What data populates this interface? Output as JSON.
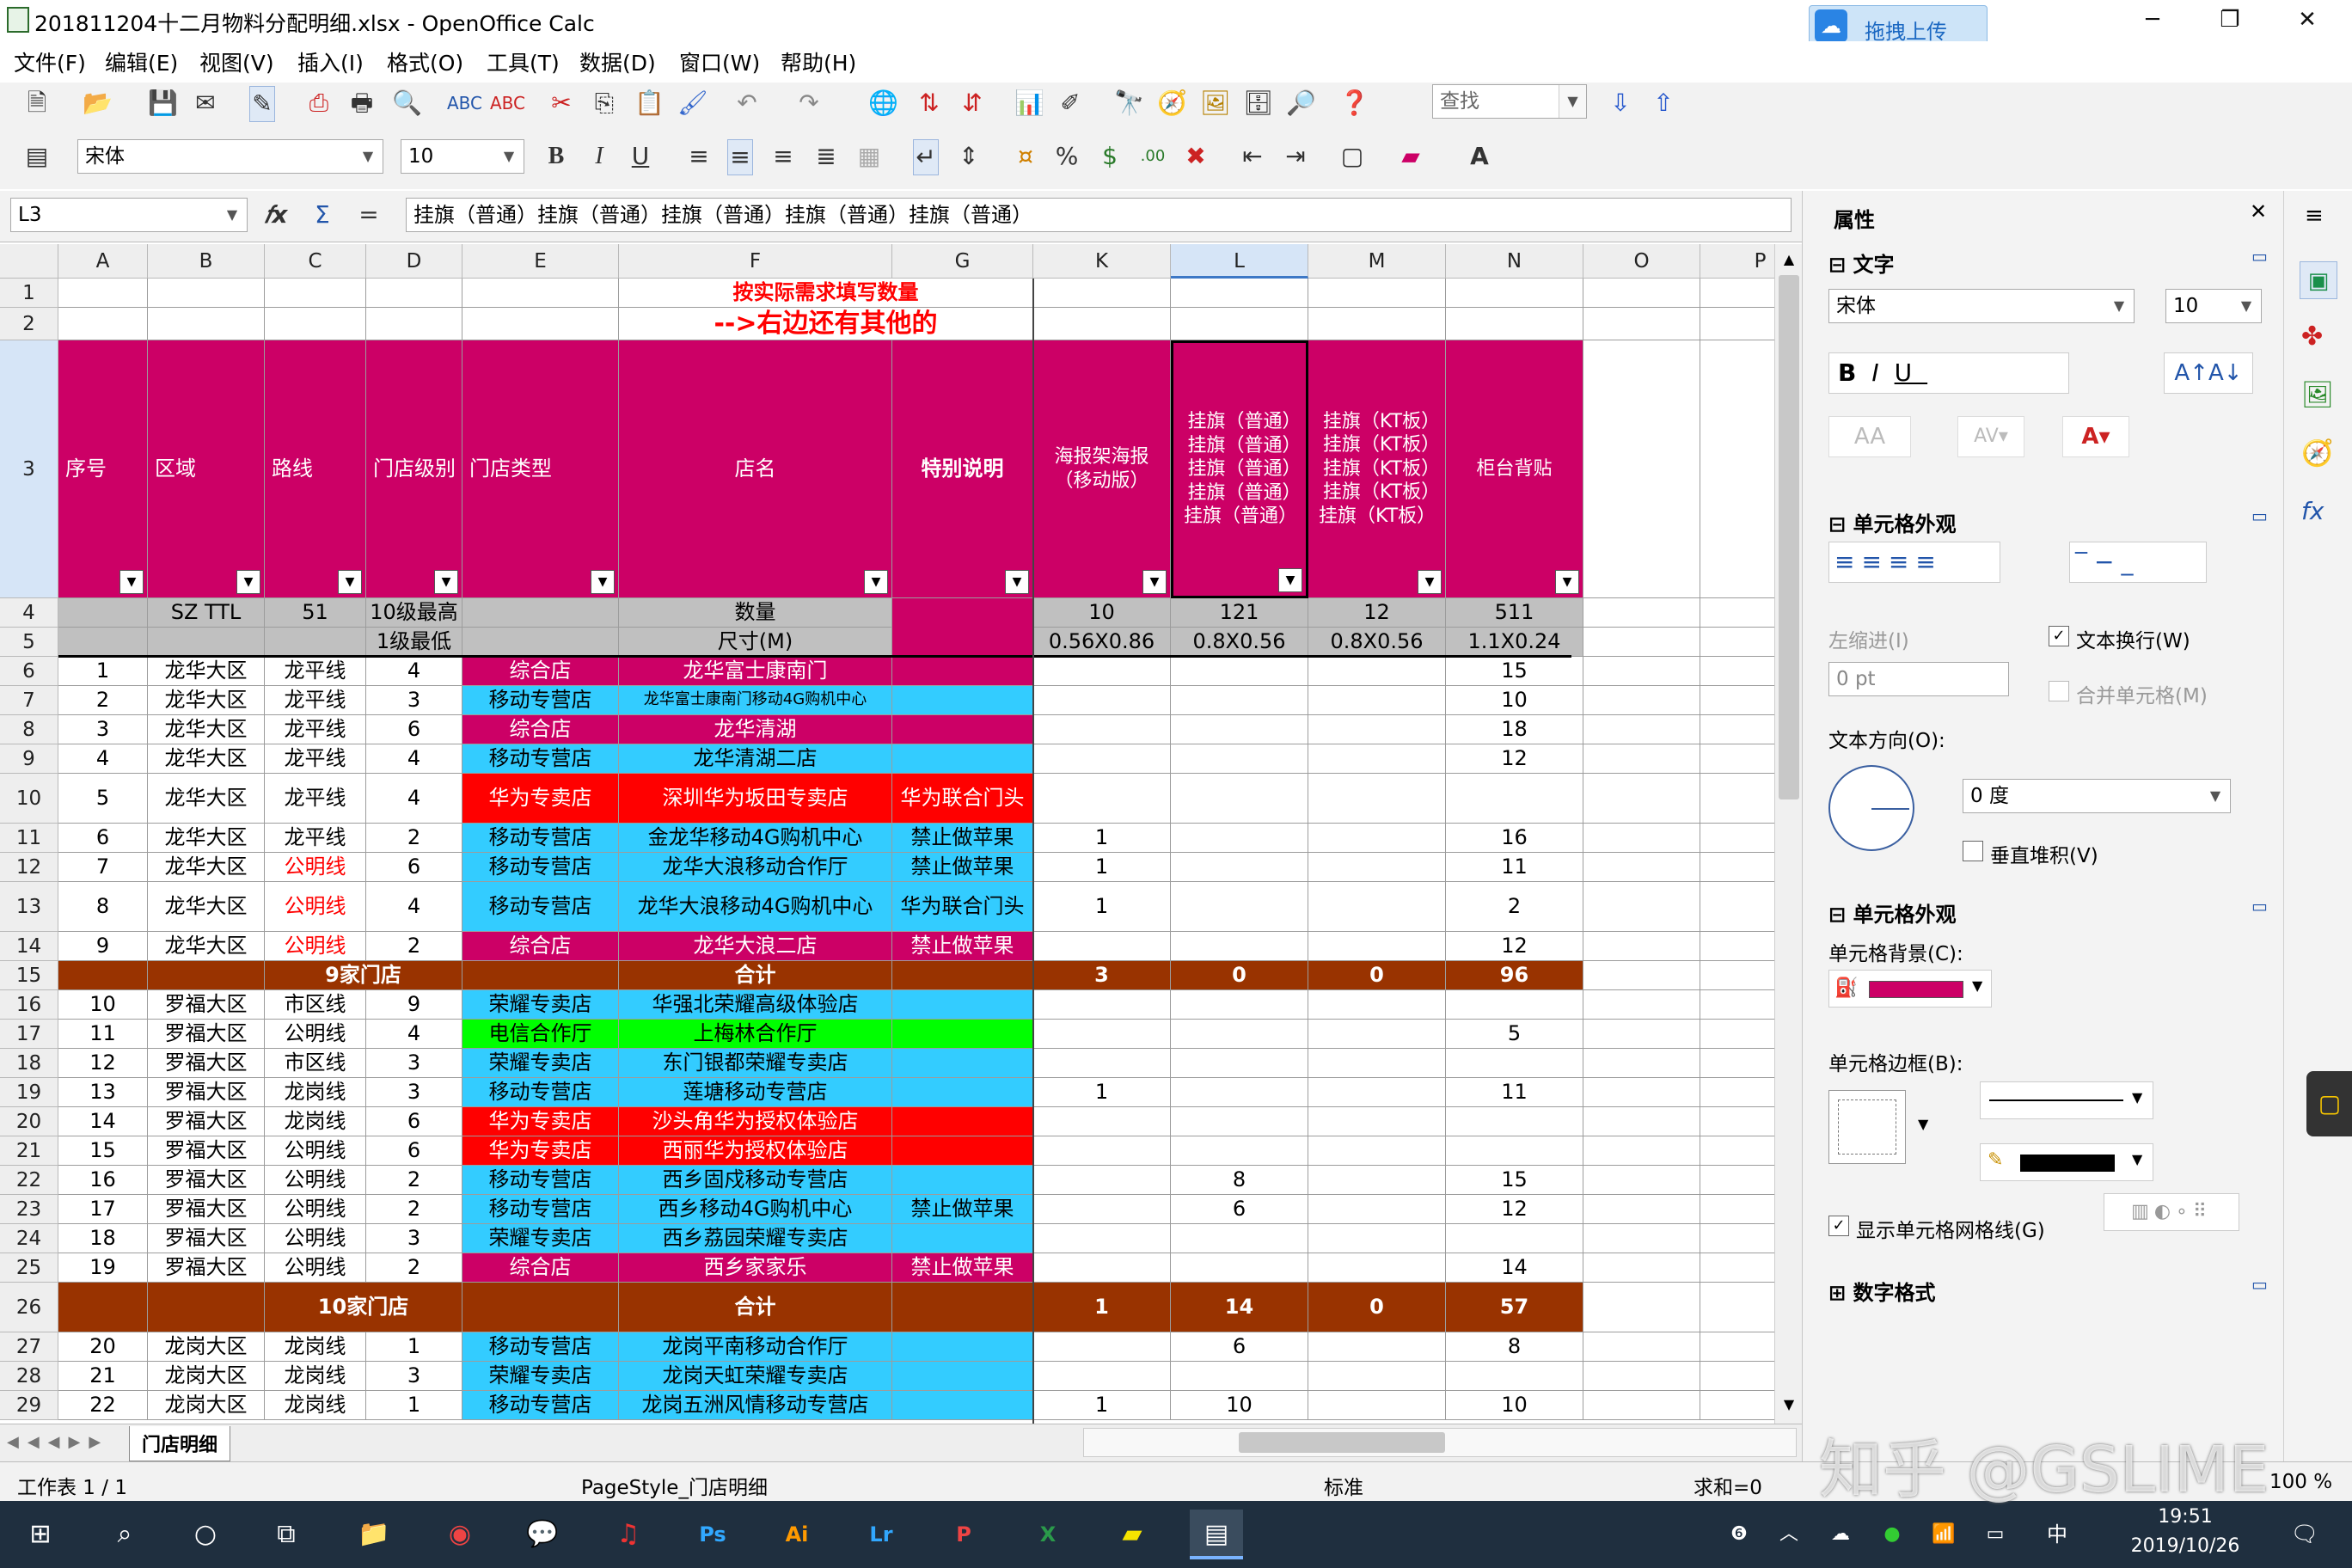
{
  "window": {
    "title": "201811204十二月物料分配明细.xlsx - OpenOffice Calc",
    "upload": "拖拽上传",
    "min": "─",
    "max": "❐",
    "close": "✕"
  },
  "menu": [
    "文件(F)",
    "编辑(E)",
    "视图(V)",
    "插入(I)",
    "格式(O)",
    "工具(T)",
    "数据(D)",
    "窗口(W)",
    "帮助(H)"
  ],
  "toolbar": {
    "find_placeholder": "查找",
    "font": "宋体",
    "size": "10",
    "bold": "B",
    "italic": "I",
    "underline": "U"
  },
  "formula": {
    "cellref": "L3",
    "fx": "𝑓x",
    "sum": "Σ",
    "eq": "=",
    "content": "挂旗（普通）挂旗（普通）挂旗（普通）挂旗（普通）挂旗（普通）"
  },
  "columns": [
    "A",
    "B",
    "C",
    "D",
    "E",
    "F",
    "G",
    "K",
    "L",
    "M",
    "N",
    "O",
    "P"
  ],
  "row_numbers": [
    "1",
    "2",
    "3",
    "4",
    "5",
    "6",
    "7",
    "8",
    "9",
    "10",
    "11",
    "12",
    "13",
    "14",
    "15",
    "16",
    "17",
    "18",
    "19",
    "20",
    "21",
    "22",
    "23",
    "24",
    "25",
    "26",
    "27",
    "28",
    "29"
  ],
  "banner": {
    "line1": "按实际需求填写数量",
    "line2": "-->右边还有其他的"
  },
  "headers": {
    "seq": "序号",
    "region": "区域",
    "route": "路线",
    "level": "门店级别",
    "type": "门店类型",
    "name": "店名",
    "note": "特别说明",
    "k": "海报架海报（移动版）",
    "l": "挂旗（普通）挂旗（普通）挂旗（普通）挂旗（普通）挂旗（普通）",
    "m": "挂旗（KT板）挂旗（KT板）挂旗（KT板）挂旗（KT板）挂旗（KT板）",
    "n": "柜台背贴"
  },
  "row4": {
    "b": "SZ TTL",
    "c": "51",
    "d": "10级最高",
    "f": "数量",
    "k": "10",
    "l": "121",
    "m": "12",
    "n": "511"
  },
  "row5": {
    "d": "1级最低",
    "f": "尺寸(M)",
    "k": "0.56X0.86",
    "l": "0.8X0.56",
    "m": "0.8X0.56",
    "n": "1.1X0.24"
  },
  "rows": [
    {
      "seq": "1",
      "region": "龙华大区",
      "route": "龙平线",
      "level": "4",
      "type": "综合店",
      "name": "龙华富士康南门",
      "note": "",
      "k": "",
      "l": "",
      "m": "",
      "n": "15"
    },
    {
      "seq": "2",
      "region": "龙华大区",
      "route": "龙平线",
      "level": "3",
      "type": "移动专营店",
      "name": "龙华富士康南门移动4G购机中心",
      "note": "",
      "k": "",
      "l": "",
      "m": "",
      "n": "10"
    },
    {
      "seq": "3",
      "region": "龙华大区",
      "route": "龙平线",
      "level": "6",
      "type": "综合店",
      "name": "龙华清湖",
      "note": "",
      "k": "",
      "l": "",
      "m": "",
      "n": "18"
    },
    {
      "seq": "4",
      "region": "龙华大区",
      "route": "龙平线",
      "level": "4",
      "type": "移动专营店",
      "name": "龙华清湖二店",
      "note": "",
      "k": "",
      "l": "",
      "m": "",
      "n": "12"
    },
    {
      "seq": "5",
      "region": "龙华大区",
      "route": "龙平线",
      "level": "4",
      "type": "华为专卖店",
      "name": "深圳华为坂田专卖店",
      "note": "华为联合门头",
      "k": "",
      "l": "",
      "m": "",
      "n": ""
    },
    {
      "seq": "6",
      "region": "龙华大区",
      "route": "龙平线",
      "level": "2",
      "type": "移动专营店",
      "name": "金龙华移动4G购机中心",
      "note": "禁止做苹果",
      "k": "1",
      "l": "",
      "m": "",
      "n": "16"
    },
    {
      "seq": "7",
      "region": "龙华大区",
      "route": "公明线",
      "level": "6",
      "type": "移动专营店",
      "name": "龙华大浪移动合作厅",
      "note": "禁止做苹果",
      "k": "1",
      "l": "",
      "m": "",
      "n": "11"
    },
    {
      "seq": "8",
      "region": "龙华大区",
      "route": "公明线",
      "level": "4",
      "type": "移动专营店",
      "name": "龙华大浪移动4G购机中心",
      "note": "华为联合门头",
      "k": "1",
      "l": "",
      "m": "",
      "n": "2"
    },
    {
      "seq": "9",
      "region": "龙华大区",
      "route": "公明线",
      "level": "2",
      "type": "综合店",
      "name": "龙华大浪二店",
      "note": "禁止做苹果",
      "k": "",
      "l": "",
      "m": "",
      "n": "12"
    },
    {
      "sub": true,
      "label": "9家门店",
      "name": "合计",
      "k": "3",
      "l": "0",
      "m": "0",
      "n": "96"
    },
    {
      "seq": "10",
      "region": "罗福大区",
      "route": "市区线",
      "level": "9",
      "type": "荣耀专卖店",
      "name": "华强北荣耀高级体验店",
      "note": "",
      "k": "",
      "l": "",
      "m": "",
      "n": ""
    },
    {
      "seq": "11",
      "region": "罗福大区",
      "route": "公明线",
      "level": "4",
      "type": "电信合作厅",
      "name": "上梅林合作厅",
      "note": "",
      "k": "",
      "l": "",
      "m": "",
      "n": "5"
    },
    {
      "seq": "12",
      "region": "罗福大区",
      "route": "市区线",
      "level": "3",
      "type": "荣耀专卖店",
      "name": "东门银都荣耀专卖店",
      "note": "",
      "k": "",
      "l": "",
      "m": "",
      "n": ""
    },
    {
      "seq": "13",
      "region": "罗福大区",
      "route": "龙岗线",
      "level": "3",
      "type": "移动专营店",
      "name": "莲塘移动专营店",
      "note": "",
      "k": "1",
      "l": "",
      "m": "",
      "n": "11"
    },
    {
      "seq": "14",
      "region": "罗福大区",
      "route": "龙岗线",
      "level": "6",
      "type": "华为专卖店",
      "name": "沙头角华为授权体验店",
      "note": "",
      "k": "",
      "l": "",
      "m": "",
      "n": ""
    },
    {
      "seq": "15",
      "region": "罗福大区",
      "route": "公明线",
      "level": "6",
      "type": "华为专卖店",
      "name": "西丽华为授权体验店",
      "note": "",
      "k": "",
      "l": "",
      "m": "",
      "n": ""
    },
    {
      "seq": "16",
      "region": "罗福大区",
      "route": "公明线",
      "level": "2",
      "type": "移动专营店",
      "name": "西乡固戍移动专营店",
      "note": "",
      "k": "",
      "l": "8",
      "m": "",
      "n": "15"
    },
    {
      "seq": "17",
      "region": "罗福大区",
      "route": "公明线",
      "level": "2",
      "type": "移动专营店",
      "name": "西乡移动4G购机中心",
      "note": "禁止做苹果",
      "k": "",
      "l": "6",
      "m": "",
      "n": "12"
    },
    {
      "seq": "18",
      "region": "罗福大区",
      "route": "公明线",
      "level": "3",
      "type": "荣耀专卖店",
      "name": "西乡荔园荣耀专卖店",
      "note": "",
      "k": "",
      "l": "",
      "m": "",
      "n": ""
    },
    {
      "seq": "19",
      "region": "罗福大区",
      "route": "公明线",
      "level": "2",
      "type": "综合店",
      "name": "西乡家家乐",
      "note": "禁止做苹果",
      "k": "",
      "l": "",
      "m": "",
      "n": "14"
    },
    {
      "sub": true,
      "label": "10家门店",
      "name": "合计",
      "k": "1",
      "l": "14",
      "m": "0",
      "n": "57"
    },
    {
      "seq": "20",
      "region": "龙岗大区",
      "route": "龙岗线",
      "level": "1",
      "type": "移动专营店",
      "name": "龙岗平南移动合作厅",
      "note": "",
      "k": "",
      "l": "6",
      "m": "",
      "n": "8"
    },
    {
      "seq": "21",
      "region": "龙岗大区",
      "route": "龙岗线",
      "level": "3",
      "type": "荣耀专卖店",
      "name": "龙岗天虹荣耀专卖店",
      "note": "",
      "k": "",
      "l": "",
      "m": "",
      "n": ""
    },
    {
      "seq": "22",
      "region": "龙岗大区",
      "route": "龙岗线",
      "level": "1",
      "type": "移动专营店",
      "name": "龙岗五洲风情移动专营店",
      "note": "",
      "k": "1",
      "l": "10",
      "m": "",
      "n": "10"
    }
  ],
  "sheet_tab": "门店明细",
  "status": {
    "sheet": "工作表 1 / 1",
    "pagestyle": "PageStyle_门店明细",
    "mode": "标准",
    "sum": "求和=0",
    "zoom": "100 %"
  },
  "sidebar": {
    "title": "属性",
    "text_section": "文字",
    "font": "宋体",
    "size": "10",
    "cell_appearance": "单元格外观",
    "wrap": "文本换行(W)",
    "indent_label": "左缩进(I)",
    "indent_value": "0 pt",
    "merge": "合并单元格(M)",
    "direction": "文本方向(O):",
    "angle": "0 度",
    "vertical": "垂直堆积(V)",
    "cell_appearance2": "单元格外观",
    "bg_label": "单元格背景(C):",
    "border_label": "单元格边框(B):",
    "gridlines": "显示单元格网格线(G)",
    "number_format": "数字格式"
  },
  "taskbar": {
    "time": "19:51",
    "date": "2019/10/26",
    "ime": "中"
  },
  "watermark": "知乎 @GSLIME",
  "colors": {
    "magenta": "#cc0066",
    "cyan": "#33ccff",
    "red": "#ff0000",
    "green": "#00ff00",
    "subtotal": "#993300",
    "grayrow": "#c0c0c0",
    "bannerText": "#ff0000"
  }
}
